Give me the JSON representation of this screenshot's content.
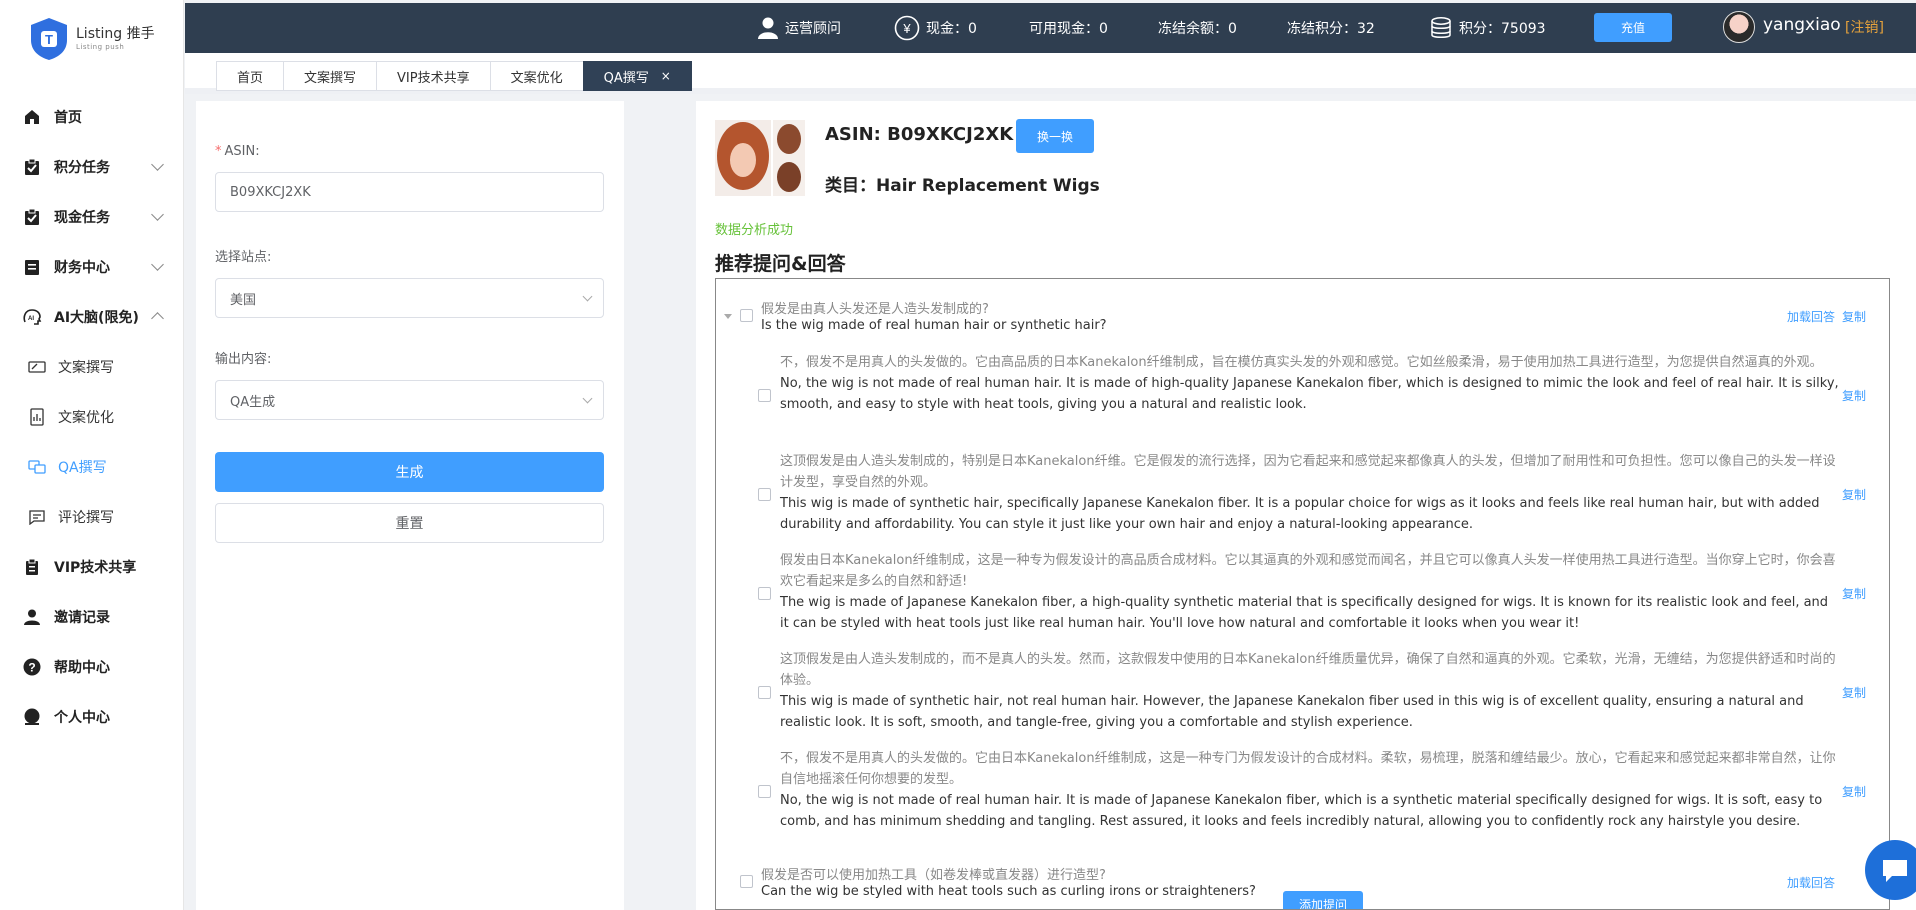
{
  "logo": {
    "title": "Listing 推手",
    "subtitle": "Listing push"
  },
  "sidebar": {
    "items": [
      {
        "label": "首页"
      },
      {
        "label": "积分任务"
      },
      {
        "label": "现金任务"
      },
      {
        "label": "财务中心"
      },
      {
        "label": "AI大脑(限免)"
      },
      {
        "label": "文案撰写"
      },
      {
        "label": "文案优化"
      },
      {
        "label": "QA撰写"
      },
      {
        "label": "评论撰写"
      },
      {
        "label": "VIP技术共享"
      },
      {
        "label": "邀请记录"
      },
      {
        "label": "帮助中心"
      },
      {
        "label": "个人中心"
      }
    ]
  },
  "topbar": {
    "advisor": "运营顾问",
    "cash": "现金：0",
    "available_cash": "可用现金：0",
    "frozen_balance": "冻结余额：0",
    "frozen_points": "冻结积分：32",
    "points": "积分：75093",
    "recharge": "充值",
    "username": "yangxiao",
    "logout": "[注销]"
  },
  "tabs": [
    {
      "label": "首页"
    },
    {
      "label": "文案撰写"
    },
    {
      "label": "VIP技术共享"
    },
    {
      "label": "文案优化"
    },
    {
      "label": "QA撰写",
      "close": "×"
    }
  ],
  "form": {
    "asin_label": "ASIN:",
    "asin_value": "B09XKCJ2XK",
    "site_label": "选择站点:",
    "site_value": "美国",
    "output_label": "输出内容:",
    "output_value": "QA生成",
    "generate": "生成",
    "reset": "重置"
  },
  "result": {
    "asin_title": "ASIN: B09XKCJ2XK",
    "change": "换一换",
    "category": "类目：Hair Replacement Wigs",
    "success": "数据分析成功",
    "section_title": "推荐提问&回答",
    "load_answer": "加载回答",
    "copy": "复制",
    "add_question": "添加提问",
    "questions": [
      {
        "cn": "假发是由真人头发还是人造头发制成的?",
        "en": "Is the wig made of real human hair or synthetic hair?",
        "answers": [
          {
            "cn": "不，假发不是用真人的头发做的。它由高品质的日本Kanekalon纤维制成，旨在模仿真实头发的外观和感觉。它如丝般柔滑，易于使用加热工具进行造型，为您提供自然逼真的外观。",
            "en": "No, the wig is not made of real human hair. It is made of high-quality Japanese Kanekalon fiber, which is designed to mimic the look and feel of real hair. It is silky, smooth, and easy to style with heat tools, giving you a natural and realistic look."
          },
          {
            "cn": "这顶假发是由人造头发制成的，特别是日本Kanekalon纤维。它是假发的流行选择，因为它看起来和感觉起来都像真人的头发，但增加了耐用性和可负担性。您可以像自己的头发一样设计发型，享受自然的外观。",
            "en": "This wig is made of synthetic hair, specifically Japanese Kanekalon fiber. It is a popular choice for wigs as it looks and feels like real human hair, but with added durability and affordability. You can style it just like your own hair and enjoy a natural-looking appearance."
          },
          {
            "cn": "假发由日本Kanekalon纤维制成，这是一种专为假发设计的高品质合成材料。它以其逼真的外观和感觉而闻名，并且它可以像真人头发一样使用热工具进行造型。当你穿上它时，你会喜欢它看起来是多么的自然和舒适!",
            "en": "The wig is made of Japanese Kanekalon fiber, a high-quality synthetic material that is specifically designed for wigs. It is known for its realistic look and feel, and it can be styled with heat tools just like real human hair. You'll love how natural and comfortable it looks when you wear it!"
          },
          {
            "cn": "这顶假发是由人造头发制成的，而不是真人的头发。然而，这款假发中使用的日本Kanekalon纤维质量优异，确保了自然和逼真的外观。它柔软，光滑，无缠结，为您提供舒适和时尚的体验。",
            "en": "This wig is made of synthetic hair, not real human hair. However, the Japanese Kanekalon fiber used in this wig is of excellent quality, ensuring a natural and realistic look. It is soft, smooth, and tangle-free, giving you a comfortable and stylish experience."
          },
          {
            "cn": "不，假发不是用真人的头发做的。它由日本Kanekalon纤维制成，这是一种专门为假发设计的合成材料。柔软，易梳理，脱落和缠结最少。放心，它看起来和感觉起来都非常自然，让你自信地摇滚任何你想要的发型。",
            "en": "No, the wig is not made of real human hair. It is made of Japanese Kanekalon fiber, which is a synthetic material specifically designed for wigs. It is soft, easy to comb, and has minimum shedding and tangling. Rest assured, it looks and feels incredibly natural, allowing you to confidently rock any hairstyle you desire."
          }
        ]
      },
      {
        "cn": "假发是否可以使用加热工具（如卷发棒或直发器）进行造型?",
        "en": "Can the wig be styled with heat tools such as curling irons or straighteners?"
      }
    ]
  },
  "colors": {
    "primary": "#409eff",
    "topbar": "#2f3e50",
    "success": "#67c23a",
    "warning": "#e6a23c"
  }
}
